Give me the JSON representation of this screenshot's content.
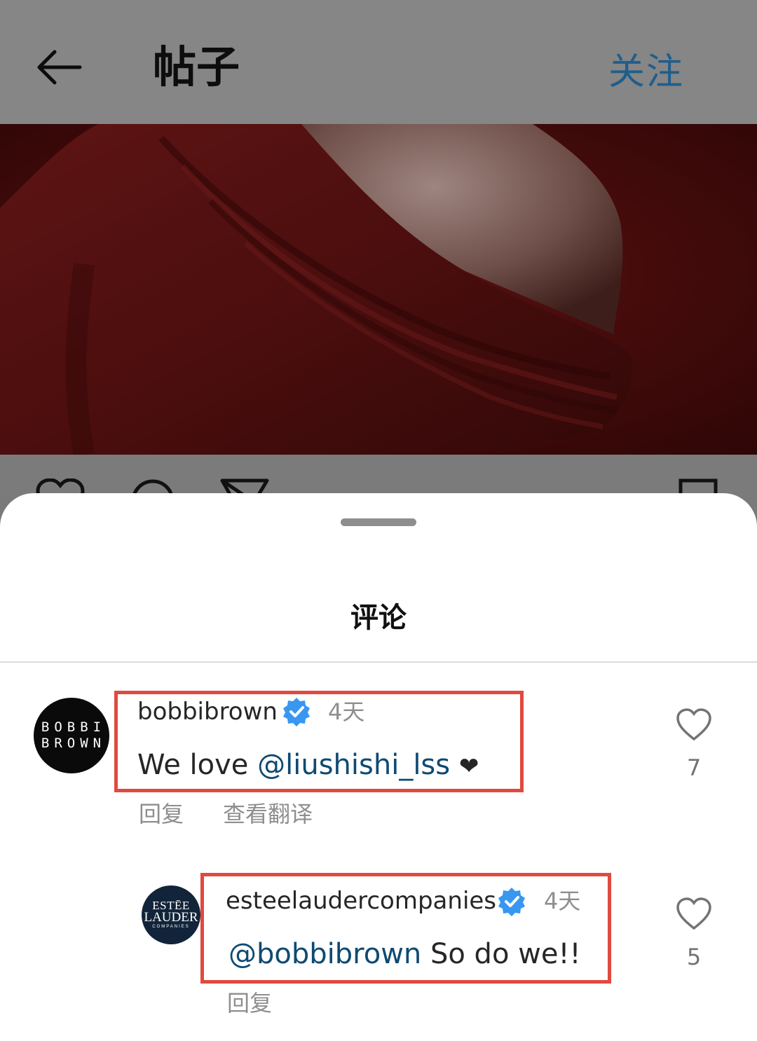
{
  "header": {
    "title": "帖子",
    "follow_label": "关注"
  },
  "sheet": {
    "title": "评论"
  },
  "comments": [
    {
      "avatar_text": [
        "BOBBI",
        "BROWN"
      ],
      "username": "bobbibrown",
      "verified": true,
      "time": "4天",
      "text_prefix": "We love ",
      "mention": "@liushishi_lss",
      "emoji": "❤",
      "reply_label": "回复",
      "translate_label": "查看翻译",
      "likes": "7"
    },
    {
      "avatar_text": [
        "ESTĒE",
        "LAUDER",
        "COMPANIES"
      ],
      "username": "esteelaudercompanies",
      "verified": true,
      "time": "4天",
      "mention": "@bobbibrown",
      "text_suffix": " So do we!!",
      "reply_label": "回复",
      "likes": "5"
    }
  ],
  "colors": {
    "accent_blue": "#1f5e8c",
    "mention": "#0e4a72",
    "verified": "#3897f0",
    "highlight_box": "#e04a3f"
  }
}
